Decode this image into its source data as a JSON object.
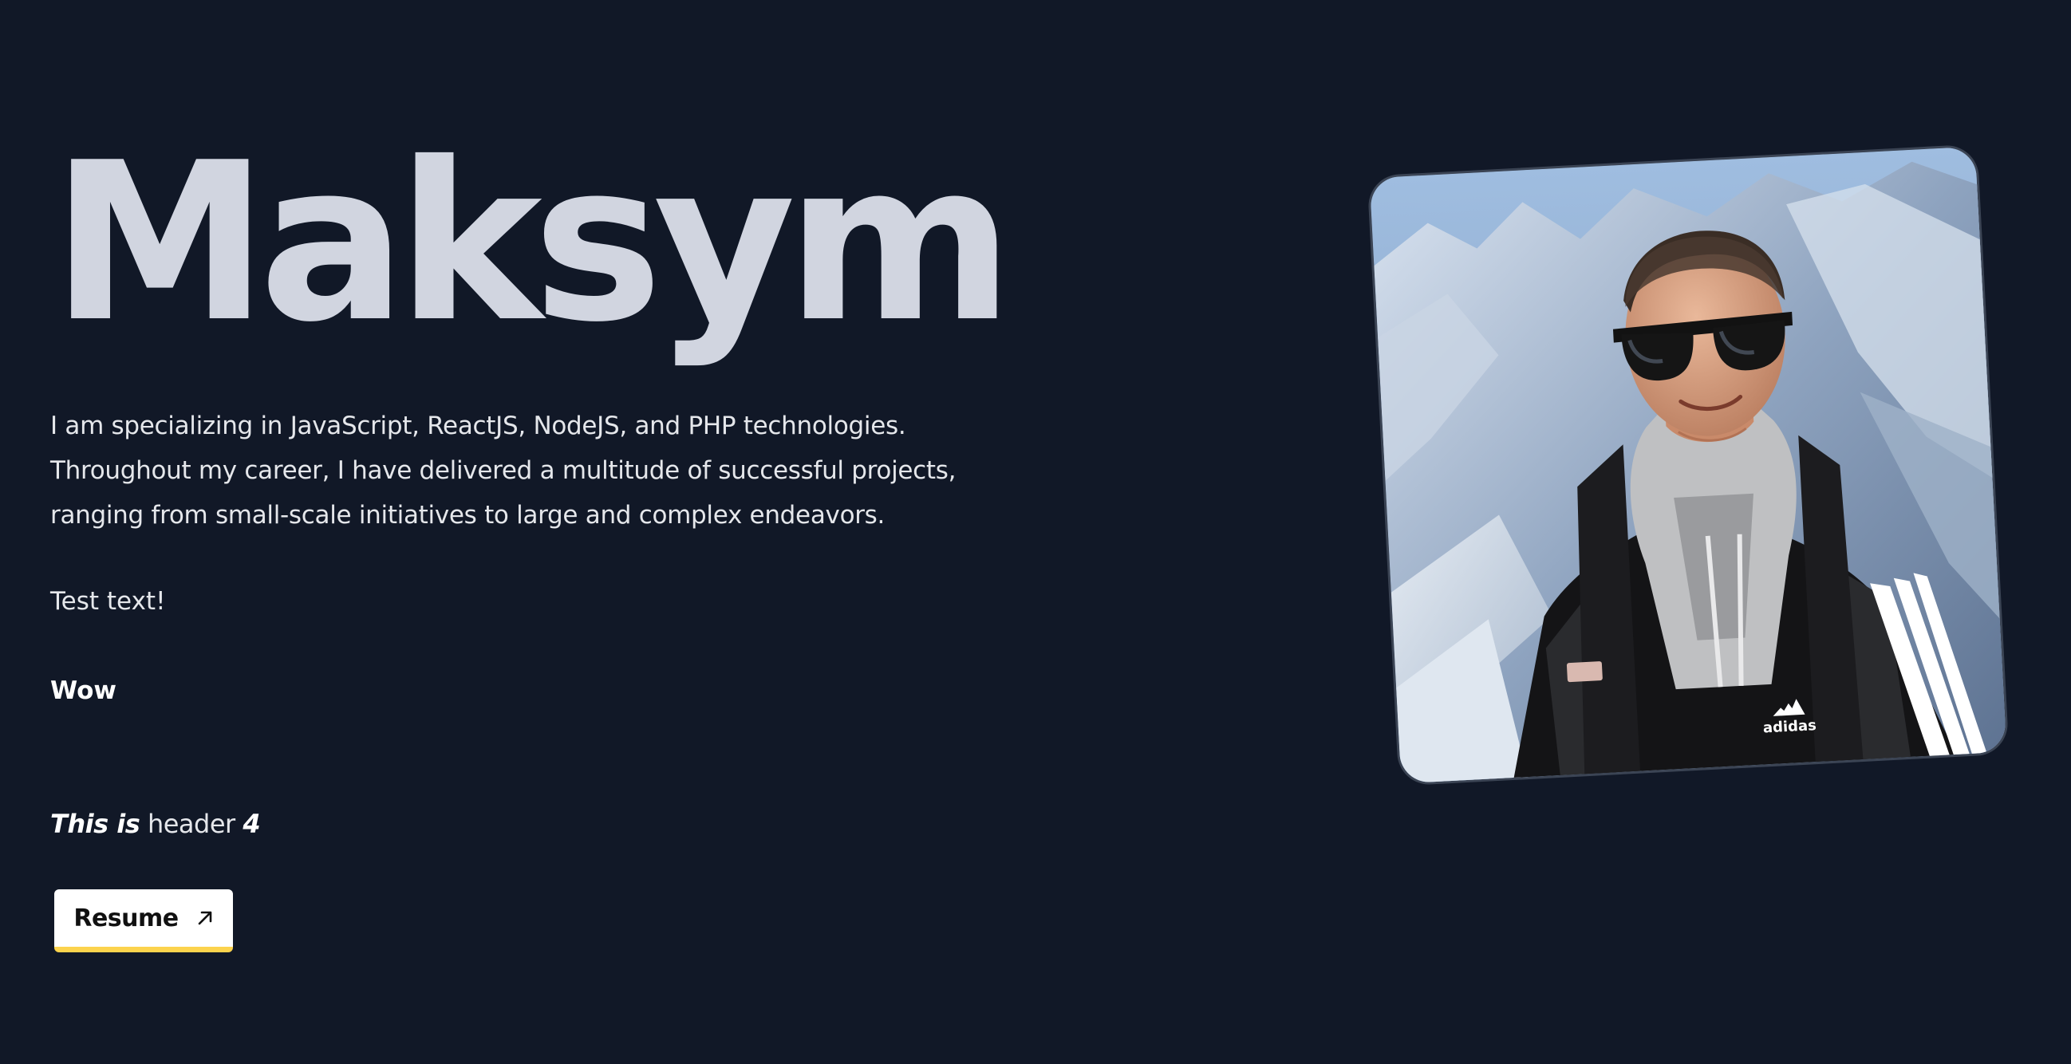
{
  "hero": {
    "name": "Maksym",
    "intro": "I am specializing in JavaScript, ReactJS, NodeJS, and PHP technologies. Throughout my career, I have delivered a multitude of successful projects, ranging from small-scale initiatives to large and complex endeavors.",
    "test_text": "Test text!",
    "wow": "Wow",
    "header4": {
      "part1": "This is",
      "part2": "header",
      "part3": "4"
    },
    "resume_button": {
      "label": "Resume",
      "icon": "arrow-up-right-icon"
    }
  },
  "photo": {
    "subject": "portrait-photo",
    "logo_text": "adidas"
  },
  "colors": {
    "background": "#111827",
    "name": "#d1d5e0",
    "text": "#e5e7eb",
    "button_bg": "#ffffff",
    "button_accent": "#fcd34d"
  }
}
